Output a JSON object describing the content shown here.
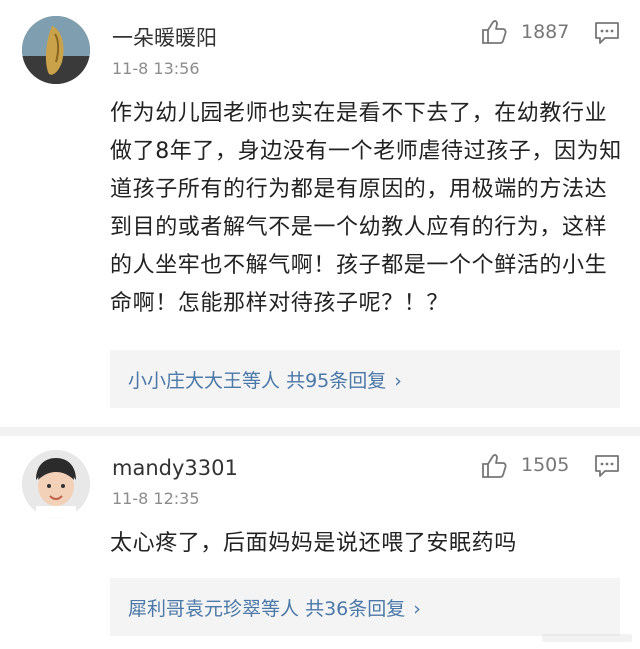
{
  "comments": [
    {
      "username": "一朵暖暖阳",
      "time": "11-8 13:56",
      "likes": "1887",
      "text": "作为幼儿园老师也实在是看不下去了，在幼教行业做了8年了，身边没有一个老师虐待过孩子，因为知道孩子所有的行为都是有原因的，用极端的方法达到目的或者解气不是一个幼教人应有的行为，这样的人坐牢也不解气啊！孩子都是一个个鲜活的小生命啊！怎能那样对待孩子呢？！？",
      "reply_users": "小小庄大大王",
      "reply_middle": "等人 ",
      "reply_count_label": "共95条回复",
      "avatar_icon": "avatar-photo",
      "like_icon": "thumbs-up-icon",
      "reply_icon": "comment-icon"
    },
    {
      "username": "mandy3301",
      "time": "11-8 12:35",
      "likes": "1505",
      "text": "太心疼了，后面妈妈是说还喂了安眠药吗",
      "reply_users": "犀利哥袁元珍翠",
      "reply_middle": "等人 ",
      "reply_count_label": "共36条回复",
      "avatar_icon": "avatar-photo",
      "like_icon": "thumbs-up-icon",
      "reply_icon": "comment-icon"
    }
  ],
  "colors": {
    "link": "#4a78a8",
    "meta": "#8c8c8c",
    "box": "#f4f4f4"
  }
}
